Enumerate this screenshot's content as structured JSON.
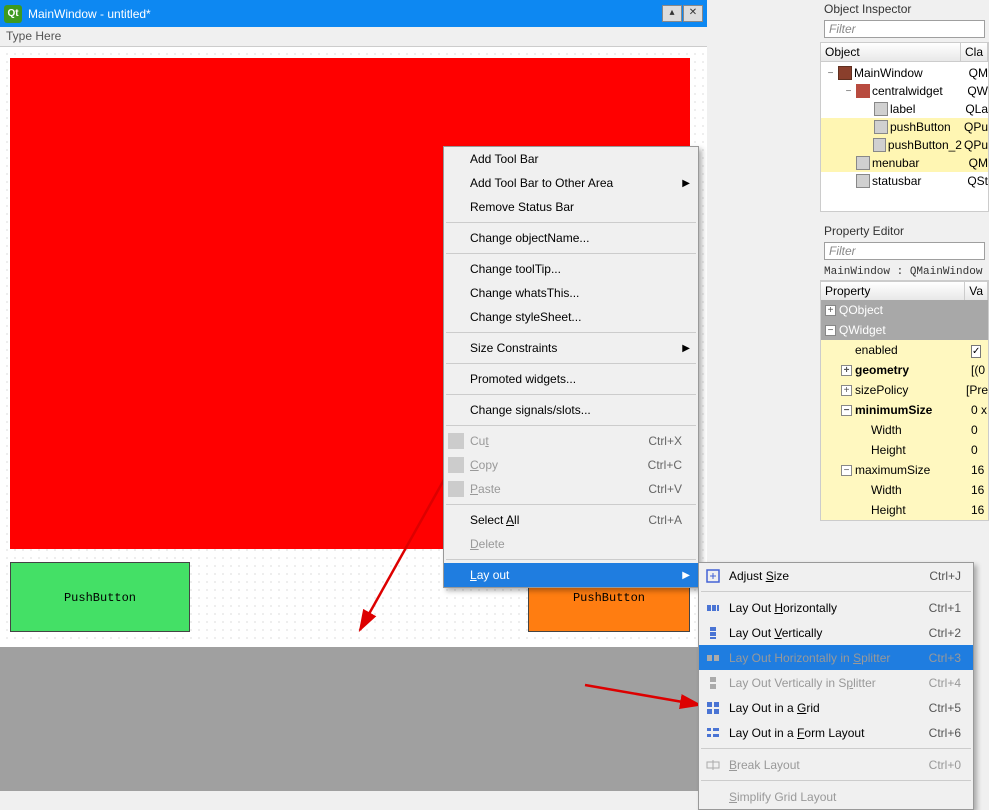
{
  "titlebar": {
    "title": "MainWindow - untitled*"
  },
  "menubar": {
    "type_here": "Type Here"
  },
  "buttons": {
    "green": "PushButton",
    "orange": "PushButton"
  },
  "inspector": {
    "title": "Object Inspector",
    "filter_placeholder": "Filter",
    "headers": {
      "object": "Object",
      "class": "Cla"
    },
    "rows": [
      {
        "name": "MainWindow",
        "cls": "QM",
        "depth": 0,
        "icon": "win",
        "exp": "−"
      },
      {
        "name": "centralwidget",
        "cls": "QW",
        "depth": 1,
        "icon": "widget",
        "exp": "−",
        "sel": false
      },
      {
        "name": "label",
        "cls": "QLa",
        "depth": 2,
        "icon": "obj"
      },
      {
        "name": "pushButton",
        "cls": "QPu",
        "depth": 2,
        "icon": "obj",
        "sel": true
      },
      {
        "name": "pushButton_2",
        "cls": "QPu",
        "depth": 2,
        "icon": "obj",
        "sel": true
      },
      {
        "name": "menubar",
        "cls": "QM",
        "depth": 1,
        "icon": "obj",
        "sel": true
      },
      {
        "name": "statusbar",
        "cls": "QSt",
        "depth": 1,
        "icon": "obj"
      }
    ]
  },
  "property_editor": {
    "title": "Property Editor",
    "filter_placeholder": "Filter",
    "context": "MainWindow : QMainWindow",
    "headers": {
      "property": "Property",
      "value": "Va"
    },
    "rows": [
      {
        "type": "cat",
        "name": "QObject",
        "exp": "+"
      },
      {
        "type": "cat",
        "name": "QWidget",
        "exp": "−"
      },
      {
        "type": "prop",
        "name": "enabled",
        "value_check": true,
        "indent": 1
      },
      {
        "type": "prop",
        "name": "geometry",
        "value": "[(0",
        "indent": 1,
        "bold": true,
        "exp": "+"
      },
      {
        "type": "prop",
        "name": "sizePolicy",
        "value": "[Pre",
        "indent": 1,
        "exp": "+"
      },
      {
        "type": "prop",
        "name": "minimumSize",
        "value": "0 x",
        "indent": 1,
        "bold": true,
        "exp": "−"
      },
      {
        "type": "prop",
        "name": "Width",
        "value": "0",
        "indent": 2
      },
      {
        "type": "prop",
        "name": "Height",
        "value": "0",
        "indent": 2
      },
      {
        "type": "prop",
        "name": "maximumSize",
        "value": "16",
        "indent": 1,
        "exp": "−"
      },
      {
        "type": "prop",
        "name": "Width",
        "value": "16",
        "indent": 2
      },
      {
        "type": "prop",
        "name": "Height",
        "value": "16",
        "indent": 2
      }
    ]
  },
  "context_menu": {
    "items": [
      {
        "label": "Add Tool Bar"
      },
      {
        "label": "Add Tool Bar to Other Area",
        "submenu": true
      },
      {
        "label": "Remove Status Bar"
      },
      {
        "sep": true
      },
      {
        "label": "Change objectName..."
      },
      {
        "sep": true
      },
      {
        "label": "Change toolTip..."
      },
      {
        "label": "Change whatsThis..."
      },
      {
        "label": "Change styleSheet..."
      },
      {
        "sep": true
      },
      {
        "label": "Size Constraints",
        "submenu": true
      },
      {
        "sep": true
      },
      {
        "label": "Promoted widgets..."
      },
      {
        "sep": true
      },
      {
        "label": "Change signals/slots..."
      },
      {
        "sep": true
      },
      {
        "label": "Cut",
        "shortcut": "Ctrl+X",
        "icon": "cut",
        "disabled": true,
        "u": 2
      },
      {
        "label": "Copy",
        "shortcut": "Ctrl+C",
        "icon": "copy",
        "disabled": true,
        "u": 0
      },
      {
        "label": "Paste",
        "shortcut": "Ctrl+V",
        "icon": "paste",
        "disabled": true,
        "u": 0
      },
      {
        "sep": true
      },
      {
        "label": "Select All",
        "shortcut": "Ctrl+A",
        "u": 7
      },
      {
        "label": "Delete",
        "disabled": true,
        "u": 0
      },
      {
        "sep": true
      },
      {
        "label": "Lay out",
        "submenu": true,
        "hl": true,
        "u": 0
      }
    ]
  },
  "layout_submenu": {
    "items": [
      {
        "label": "Adjust Size",
        "shortcut": "Ctrl+J",
        "icon": "adjust",
        "u": 7
      },
      {
        "sep": true
      },
      {
        "label": "Lay Out Horizontally",
        "shortcut": "Ctrl+1",
        "icon": "h",
        "u": 8
      },
      {
        "label": "Lay Out Vertically",
        "shortcut": "Ctrl+2",
        "icon": "v",
        "u": 8
      },
      {
        "label": "Lay Out Horizontally in Splitter",
        "shortcut": "Ctrl+3",
        "icon": "hs",
        "disabled": true,
        "hl": true,
        "u": 24
      },
      {
        "label": "Lay Out Vertically in Splitter",
        "shortcut": "Ctrl+4",
        "icon": "vs",
        "disabled": true,
        "u": 23
      },
      {
        "label": "Lay Out in a Grid",
        "shortcut": "Ctrl+5",
        "icon": "grid",
        "u": 13
      },
      {
        "label": "Lay Out in a Form Layout",
        "shortcut": "Ctrl+6",
        "icon": "form",
        "u": 13
      },
      {
        "sep": true
      },
      {
        "label": "Break Layout",
        "shortcut": "Ctrl+0",
        "icon": "break",
        "disabled": true,
        "u": 0
      },
      {
        "sep": true
      },
      {
        "label": "Simplify Grid Layout",
        "disabled": true,
        "u": 0
      }
    ]
  }
}
